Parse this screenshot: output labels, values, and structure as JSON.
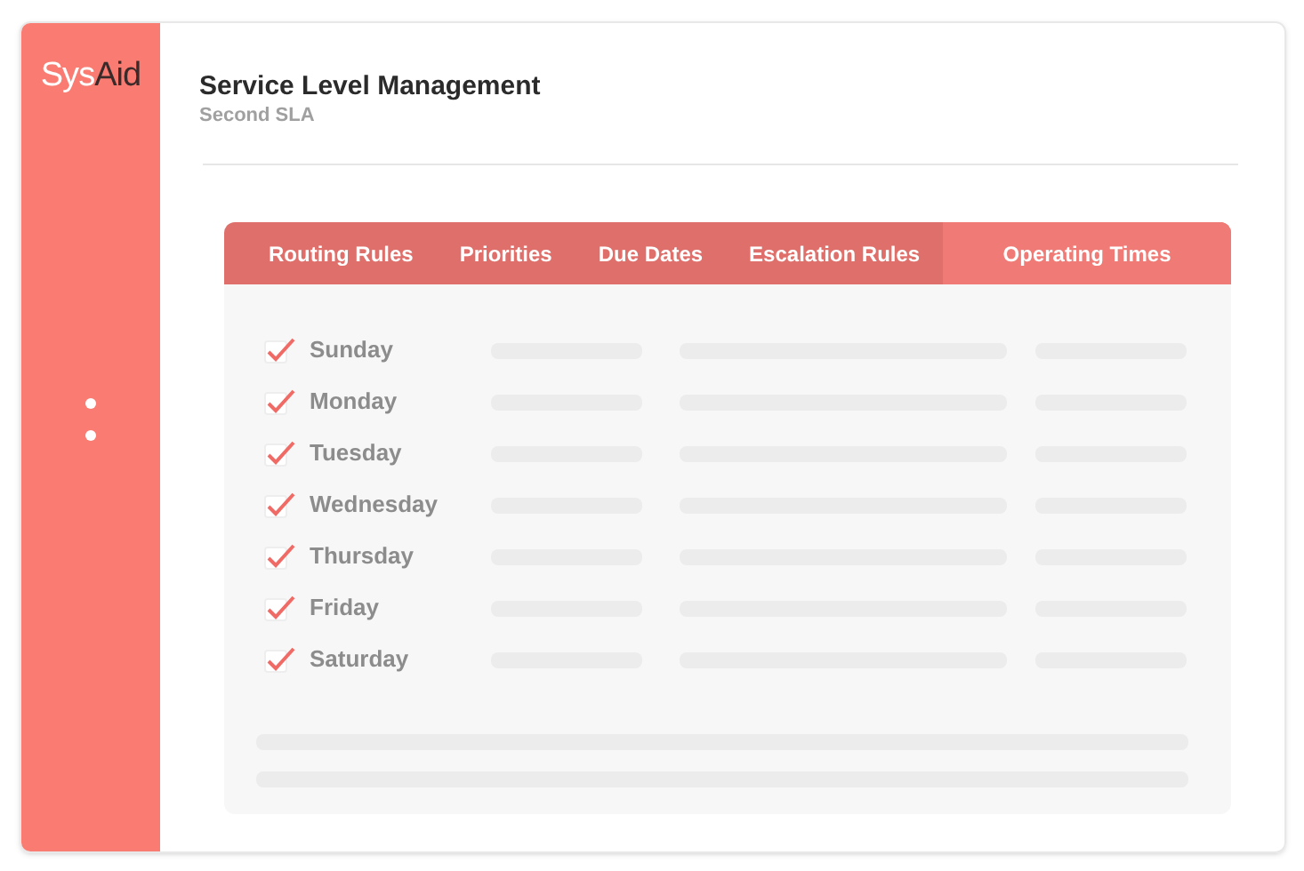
{
  "logo": {
    "light": "Sys",
    "dark": "Aid"
  },
  "header": {
    "title": "Service Level Management",
    "subtitle": "Second SLA"
  },
  "tabs": [
    {
      "label": "Routing Rules",
      "selected": false
    },
    {
      "label": "Priorities",
      "selected": false
    },
    {
      "label": "Due Dates",
      "selected": false
    },
    {
      "label": "Escalation Rules",
      "selected": false
    },
    {
      "label": "Operating Times",
      "selected": true
    }
  ],
  "days": [
    {
      "label": "Sunday",
      "checked": true
    },
    {
      "label": "Monday",
      "checked": true
    },
    {
      "label": "Tuesday",
      "checked": true
    },
    {
      "label": "Wednesday",
      "checked": true
    },
    {
      "label": "Thursday",
      "checked": true
    },
    {
      "label": "Friday",
      "checked": true
    },
    {
      "label": "Saturday",
      "checked": true
    }
  ]
}
